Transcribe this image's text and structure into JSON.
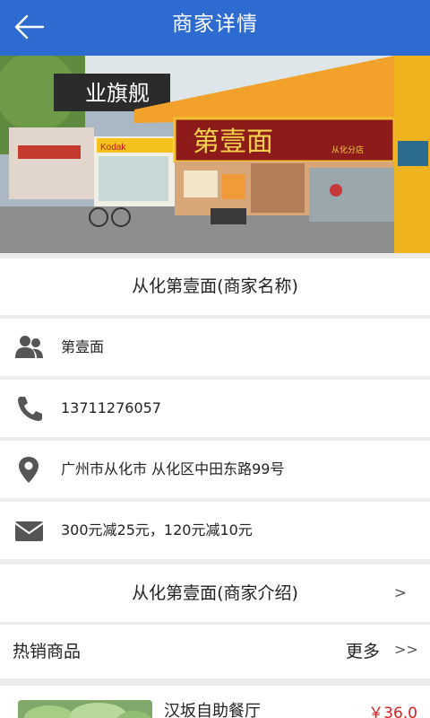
{
  "header": {
    "title": "商家详情",
    "back_icon": "back-arrow-icon"
  },
  "merchant": {
    "name": "从化第壹面(商家名称)",
    "info_rows": [
      {
        "icon": "group-icon",
        "text": "第壹面"
      },
      {
        "icon": "phone-icon",
        "text": "13711276057"
      },
      {
        "icon": "location-pin-icon",
        "text": "广州市从化市 从化区中田东路99号"
      },
      {
        "icon": "mail-icon",
        "text": "300元减25元，120元减10元"
      }
    ],
    "intro": "从化第壹面(商家介绍)",
    "intro_arrow": ">"
  },
  "banner": {
    "sign_text": "第壹面",
    "sign_sub": "从化分店",
    "left_sign": "业旗舰",
    "shop_sign": "Kodak"
  },
  "hot_products": {
    "label": "热销商品",
    "more": "更多",
    "more_arrow": ">>",
    "items": [
      {
        "name": "汉坂自助餐厅",
        "price": "￥36.0"
      }
    ]
  },
  "colors": {
    "header": "#2d6bd0",
    "price": "#d42020",
    "icon": "#555555"
  }
}
